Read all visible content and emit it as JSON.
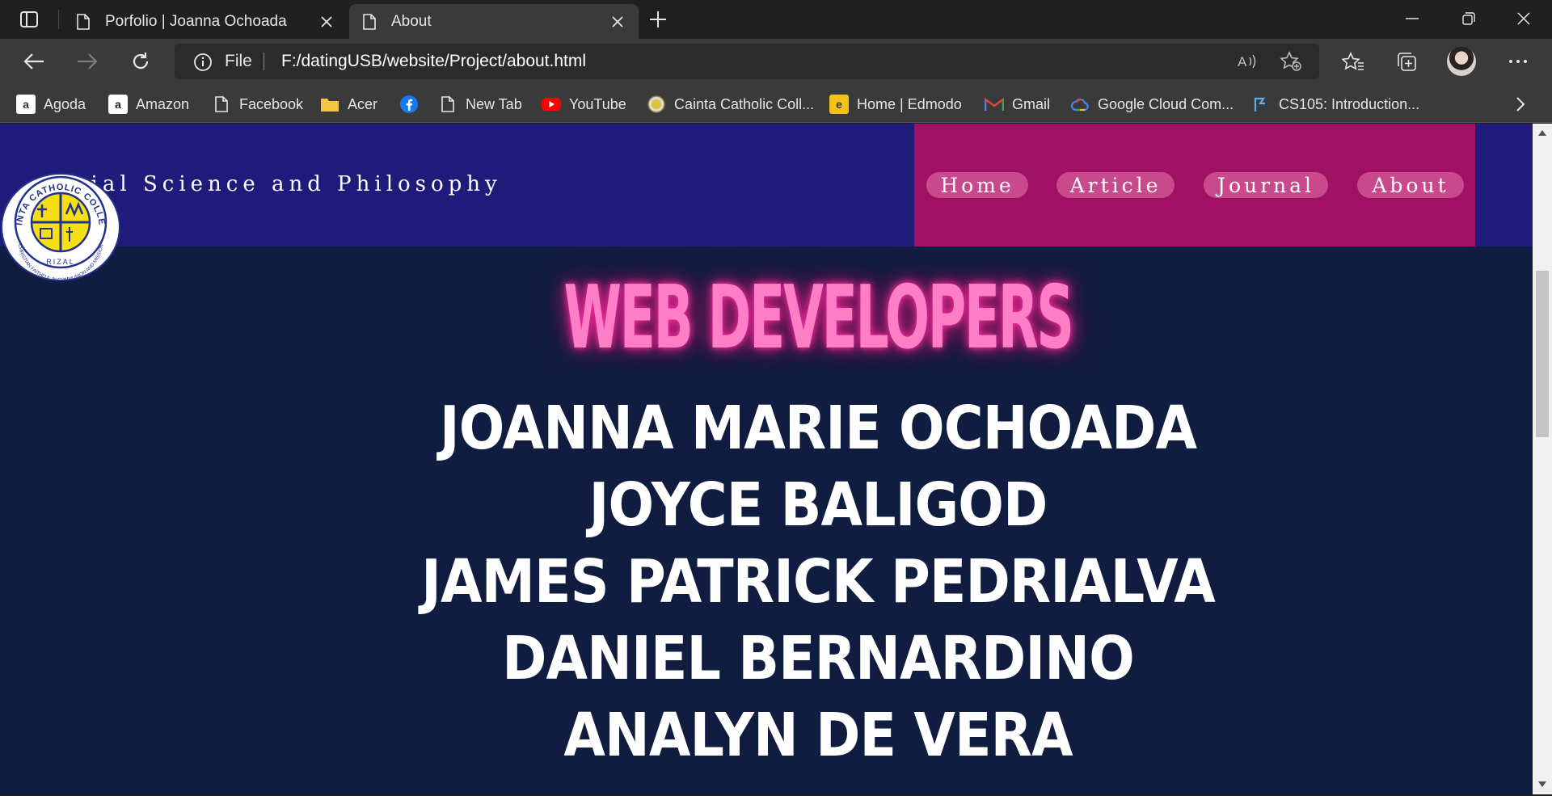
{
  "browser": {
    "tabs": [
      {
        "title": "Porfolio | Joanna Ochoada",
        "active": false
      },
      {
        "title": "About",
        "active": true
      }
    ],
    "address": {
      "scheme_label": "File",
      "url": "F:/datingUSB/website/Project/about.html"
    },
    "favorites": [
      {
        "label": "Agoda",
        "icon": "agoda-icon"
      },
      {
        "label": "Amazon",
        "icon": "amazon-icon"
      },
      {
        "label": "Facebook",
        "icon": "page-icon"
      },
      {
        "label": "Acer",
        "icon": "folder-icon"
      },
      {
        "label": "",
        "icon": "facebook-icon"
      },
      {
        "label": "New Tab",
        "icon": "page-icon"
      },
      {
        "label": "YouTube",
        "icon": "youtube-icon"
      },
      {
        "label": "Cainta Catholic Coll...",
        "icon": "school-icon"
      },
      {
        "label": "Home | Edmodo",
        "icon": "edmodo-icon"
      },
      {
        "label": "Gmail",
        "icon": "gmail-icon"
      },
      {
        "label": "Google Cloud Com...",
        "icon": "google-cloud-icon"
      },
      {
        "label": "CS105: Introduction...",
        "icon": "saylor-icon"
      }
    ]
  },
  "page": {
    "site_title": "cial Science and Philosophy",
    "nav": [
      {
        "label": "Home"
      },
      {
        "label": "Article"
      },
      {
        "label": "Journal"
      },
      {
        "label": "About"
      }
    ],
    "hero_title": "WEB DEVELOPERS",
    "developers": [
      "JOANNA MARIE OCHOADA",
      "JOYCE BALIGOD",
      "JAMES PATRICK PEDRIALVA",
      "DANIEL BERNARDINO",
      "ANALYN DE VERA"
    ],
    "logo": {
      "arc_text": "CAINTA CATHOLIC COLLEGE",
      "bottom_text": "RIZAL",
      "motto": "CHRISTIAN FAITHFUL IN COMMUNION AND MISSION"
    }
  },
  "colors": {
    "header_band": "#1f1b7a",
    "nav_panel": "#a01166",
    "nav_pill": "#c84a8c",
    "page_bg": "#101c40",
    "hero_text": "#ff7fc6"
  }
}
